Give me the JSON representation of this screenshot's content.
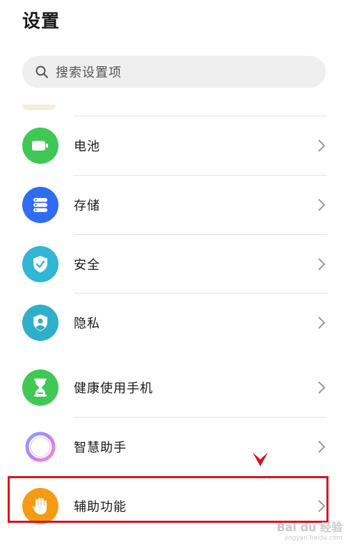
{
  "header": {
    "title": "设置"
  },
  "search": {
    "placeholder": "搜索设置项"
  },
  "items": [
    {
      "label": "电池",
      "icon": "battery-icon",
      "color": "#3fc853"
    },
    {
      "label": "存储",
      "icon": "storage-icon",
      "color": "#2f6cf0"
    },
    {
      "label": "安全",
      "icon": "shield-icon",
      "color": "#33b5d4"
    },
    {
      "label": "隐私",
      "icon": "privacy-icon",
      "color": "#2eb0c8"
    },
    {
      "label": "健康使用手机",
      "icon": "hourglass-icon",
      "color": "#3fc853"
    },
    {
      "label": "智慧助手",
      "icon": "assistant-ring-icon",
      "color": "#b57cf3"
    },
    {
      "label": "辅助功能",
      "icon": "hand-icon",
      "color": "#f59b16"
    }
  ],
  "annotation": {
    "highlight_color": "#d9111c",
    "highlighted_item": "辅助功能"
  },
  "watermark": {
    "brand": "Bai du 经验",
    "url": "jingyan.baidu.com"
  }
}
